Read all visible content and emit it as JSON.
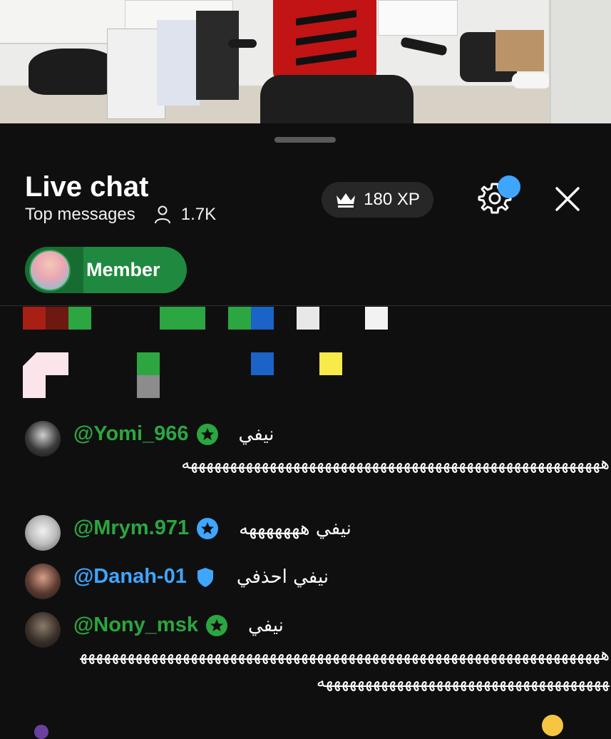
{
  "chat": {
    "title": "Live chat",
    "mode": "Top messages",
    "viewers": "1.7K",
    "xp": "180 XP",
    "member_label": "Member"
  },
  "colors": {
    "accent_green": "#2ba640",
    "accent_blue": "#3ea6ff",
    "member_chip": "#1f8a3f",
    "panel_bg": "#0f0f0f"
  },
  "color_blocks": {
    "row1": [
      "#a81f14",
      "#6e1812",
      "#2ba640",
      "#2ba640",
      "#2ba640",
      "#2ba640",
      "#1b63c6",
      "#e8e8e8",
      "#f2f2f2"
    ],
    "row2": [
      "#fbe4ea",
      "#2ba640",
      "#8c8c8c",
      "#1b63c6",
      "#f7ea4a"
    ]
  },
  "messages": [
    {
      "user": "@Yomi_966",
      "badge": "star-icon",
      "text": "نيفي",
      "continuation": "هههههههههههههههههههههههههههههههههههههههههههههههههههههه"
    },
    {
      "user": "@Mrym.971",
      "badge": "star-icon",
      "text": "نيفي هههههههه",
      "continuation": ""
    },
    {
      "user": "@Danah-01",
      "badge": "shield-icon",
      "text": "نيفي احذفي",
      "continuation": ""
    },
    {
      "user": "@Nony_msk",
      "badge": "star-icon",
      "text": "نيفي",
      "continuation": "هههههههههههههههههههههههههههههههههههههههههههههههههههههههههههههههههههههههههههههههههههههههههههههههههههههههه"
    }
  ]
}
